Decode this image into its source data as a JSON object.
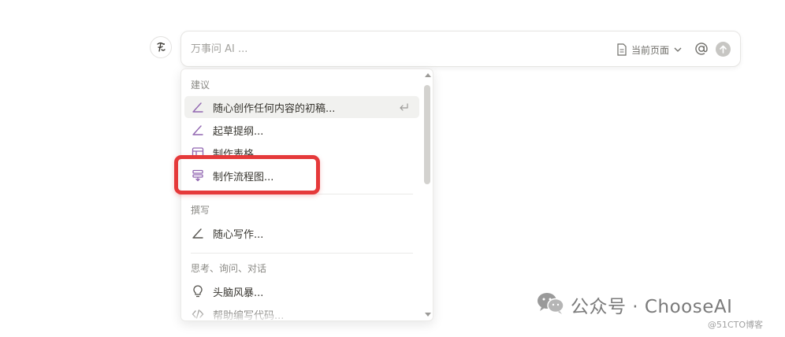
{
  "ai": {
    "avatar_icon": "notion-ai-face-icon",
    "input_placeholder": "万事问 AI ...",
    "context_label": "当前页面",
    "context_icon": "page-icon",
    "mention_icon": "at-icon",
    "send_icon": "send-arrow-up-icon"
  },
  "menu": {
    "sections": [
      {
        "title": "建议",
        "items": [
          {
            "label": "随心创作任何内容的初稿...",
            "icon": "pen-icon",
            "active": true
          },
          {
            "label": "起草提纲...",
            "icon": "pen-icon"
          },
          {
            "label": "制作表格...",
            "icon": "table-icon"
          },
          {
            "label": "制作流程图...",
            "icon": "flowchart-icon"
          }
        ]
      },
      {
        "title": "撰写",
        "items": [
          {
            "label": "随心写作...",
            "icon": "pen-icon"
          }
        ]
      },
      {
        "title": "思考、询问、对话",
        "items": [
          {
            "label": "头脑风暴...",
            "icon": "lightbulb-icon"
          },
          {
            "label": "帮助编写代码...",
            "icon": "code-icon"
          }
        ]
      }
    ],
    "enter_icon": "enter-return-icon"
  },
  "annotation": {
    "color": "#e5393a"
  },
  "watermark": {
    "logo_icon": "wechat-logo-icon",
    "text": "公众号 · ChooseAI",
    "small_text": "@51CTO博客"
  },
  "colors": {
    "accent_purple": "#9065b0",
    "text": "#37352f",
    "muted": "#8a8984"
  }
}
